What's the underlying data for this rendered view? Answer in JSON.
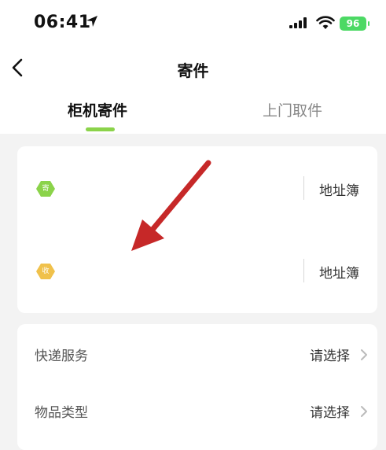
{
  "status_bar": {
    "time": "06:41",
    "battery": "96"
  },
  "nav": {
    "title": "寄件"
  },
  "tabs": [
    {
      "label": "柜机寄件"
    },
    {
      "label": "上门取件"
    }
  ],
  "address": {
    "sender": {
      "badge": "寄",
      "link": "地址簿"
    },
    "receiver": {
      "badge": "收",
      "link": "地址簿"
    }
  },
  "service": {
    "rows": [
      {
        "label": "快递服务",
        "value": "请选择"
      },
      {
        "label": "物品类型",
        "value": "请选择"
      }
    ]
  },
  "colors": {
    "accent": "#8bd34a",
    "sender_badge": "#8bd34a",
    "receiver_badge": "#f0c14b",
    "annotation_arrow": "#c62828"
  }
}
